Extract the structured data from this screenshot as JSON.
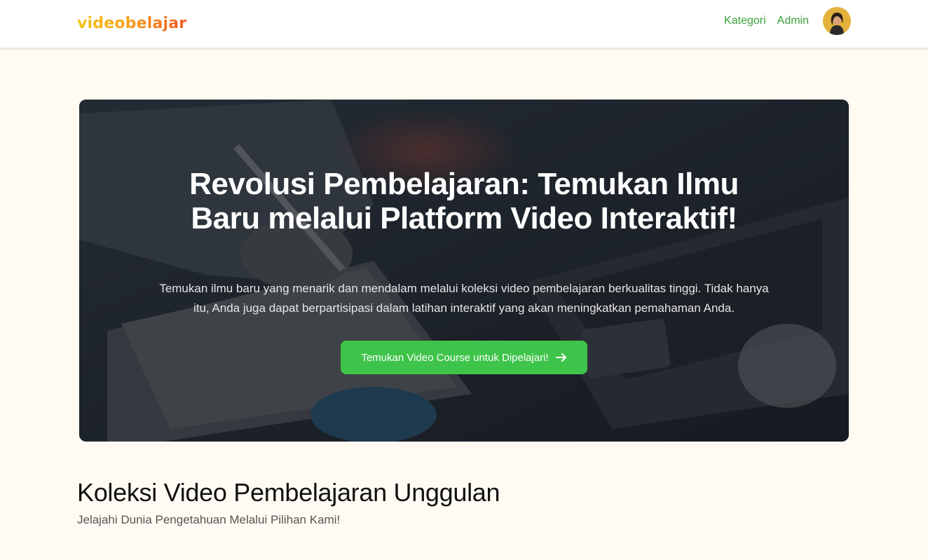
{
  "navbar": {
    "logo": "videobelajar",
    "links": [
      "Kategori",
      "Admin"
    ],
    "avatar_icon": "user-avatar"
  },
  "hero": {
    "title": "Revolusi Pembelajaran: Temukan Ilmu Baru melalui Platform Video Interaktif!",
    "description": "Temukan ilmu baru yang menarik dan mendalam melalui koleksi video pembelajaran berkualitas tinggi. Tidak hanya itu, Anda juga dapat berpartisipasi dalam latihan interaktif yang akan meningkatkan pemahaman Anda.",
    "button_label": "Temukan Video Course untuk Dipelajari!",
    "button_icon": "arrow-right-icon"
  },
  "section": {
    "title": "Koleksi Video Pembelajaran Unggulan",
    "subtitle": "Jelajahi Dunia Pengetahuan Melalui Pilihan Kami!"
  },
  "colors": {
    "accent_green": "#3ec44a",
    "link_green": "#3a9f3a",
    "page_background": "#fffbf3",
    "logo_gradient": [
      "#f5c518",
      "#f15a24"
    ]
  }
}
